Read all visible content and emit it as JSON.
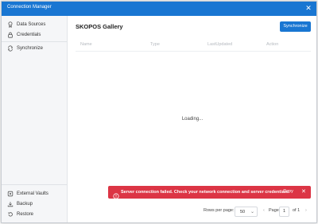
{
  "window": {
    "title": "Connection Manager",
    "close_glyph": "✕"
  },
  "sidebar": {
    "top_items": [
      {
        "label": "Data Sources",
        "icon": "database-icon"
      },
      {
        "label": "Credentials",
        "icon": "lock-icon"
      },
      {
        "label": "Synchronize",
        "icon": "sync-icon"
      }
    ],
    "bottom_items": [
      {
        "label": "External Vaults",
        "icon": "vault-icon"
      },
      {
        "label": "Backup",
        "icon": "backup-icon"
      },
      {
        "label": "Restore",
        "icon": "restore-icon"
      }
    ]
  },
  "main": {
    "title": "SKOPOS Gallery",
    "sync_button": "Synchronize",
    "columns": [
      "Name",
      "Type",
      "LastUpdated",
      "Action"
    ],
    "loading_text": "Loading..."
  },
  "toast": {
    "message": "Server connection failed. Check your network connection and server credentials.",
    "copy_label": "Copy",
    "close_glyph": "✕",
    "color": "#dc3545"
  },
  "pagination": {
    "rows_label": "Rows per page:",
    "rows_value": "50",
    "prev_glyph": "‹",
    "page_label": "Page",
    "page_value": "1",
    "of_label": "of 1",
    "next_glyph": "›"
  },
  "colors": {
    "accent": "#1976d2",
    "sidebar_bg": "#f5f6f8"
  }
}
